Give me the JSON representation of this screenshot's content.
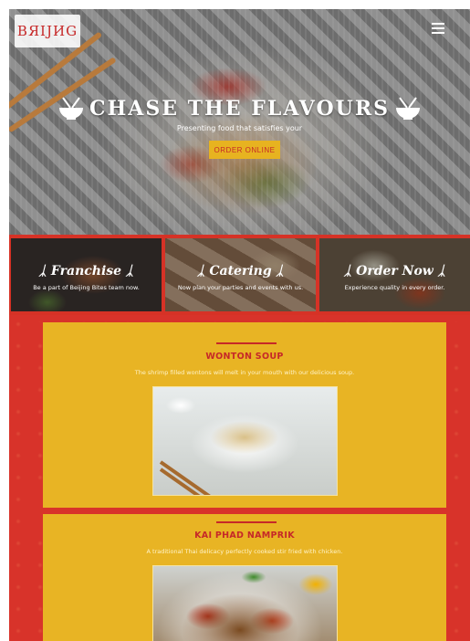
{
  "brand": {
    "logo_text": "BЯIJИG"
  },
  "header": {
    "menu_icon": "hamburger-menu-icon"
  },
  "hero": {
    "title": "CHASE THE FLAVOURS",
    "subtitle": "Presenting food that satisfies your",
    "cta_label": "ORDER ONLINE",
    "icon": "bowl-chopsticks-icon"
  },
  "categories": [
    {
      "title": "Franchise",
      "subtitle": "Be a part of Beijing Bites team now."
    },
    {
      "title": "Catering",
      "subtitle": "Now plan your parties and events with us."
    },
    {
      "title": "Order Now",
      "subtitle": "Experience quality in every order."
    }
  ],
  "dishes": [
    {
      "name": "WONTON SOUP",
      "description": "The shrimp filled wontons will melt in your mouth with our delicious soup."
    },
    {
      "name": "KAI PHAD NAMPRIK",
      "description": "A traditional Thai delicacy perfectly cooked stir fried with chicken."
    }
  ],
  "colors": {
    "brand_red": "#c62828",
    "section_red": "#d8332a",
    "panel_yellow": "#e8b424",
    "button_yellow": "#e7b320"
  }
}
